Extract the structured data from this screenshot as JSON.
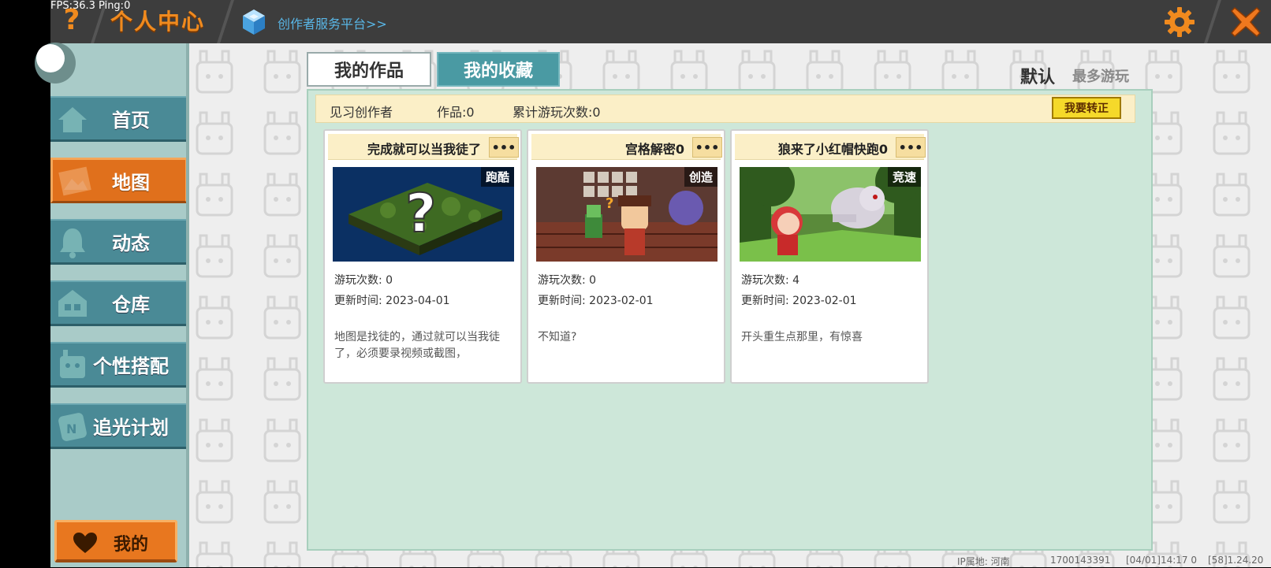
{
  "status": {
    "fps": "FPS:36.3  Ping:0"
  },
  "header": {
    "title": "个人中心",
    "creator_link": "创作者服务平台>>"
  },
  "sidebar": {
    "items": [
      {
        "label": "首页",
        "icon": "home-icon",
        "active": false
      },
      {
        "label": "地图",
        "icon": "map-icon",
        "active": true
      },
      {
        "label": "动态",
        "icon": "bell-icon",
        "active": false
      },
      {
        "label": "仓库",
        "icon": "warehouse-icon",
        "active": false
      },
      {
        "label": "个性搭配",
        "icon": "avatar-icon",
        "active": false
      },
      {
        "label": "追光计划",
        "icon": "plan-icon",
        "active": false
      }
    ],
    "mine_label": "我的"
  },
  "tabs": {
    "works": "我的作品",
    "favorites": "我的收藏"
  },
  "sort": {
    "default": "默认",
    "most_played": "最多游玩"
  },
  "creator_info": {
    "level": "见习创作者",
    "works": "作品:0",
    "plays": "累计游玩次数:0",
    "correct_button": "我要转正"
  },
  "cards": [
    {
      "title": "完成就可以当我徒了",
      "more": "•••",
      "tag": "跑酷",
      "plays": "游玩次数: 0",
      "updated": "更新时间: 2023-04-01",
      "description": "地图是找徒的，通过就可以当我徒了，必须要录视频或截图，"
    },
    {
      "title": "宫格解密0",
      "more": "•••",
      "tag": "创造",
      "plays": "游玩次数: 0",
      "updated": "更新时间: 2023-02-01",
      "description": "不知道?"
    },
    {
      "title": "狼来了小红帽快跑0",
      "more": "•••",
      "tag": "竞速",
      "plays": "游玩次数: 4",
      "updated": "更新时间: 2023-02-01",
      "description": "开头重生点那里，有惊喜"
    }
  ],
  "footer": {
    "ip": "IP属地: 河南",
    "uid": "1700143391",
    "time": "[04/01]14:17 0",
    "version": "[58]1.24.20"
  },
  "colors": {
    "accent_orange": "#e0701c",
    "teal": "#4a8a96",
    "panel_green": "#cde7d9",
    "info_yellow": "#fbefc7",
    "button_yellow": "#f5d92a"
  }
}
